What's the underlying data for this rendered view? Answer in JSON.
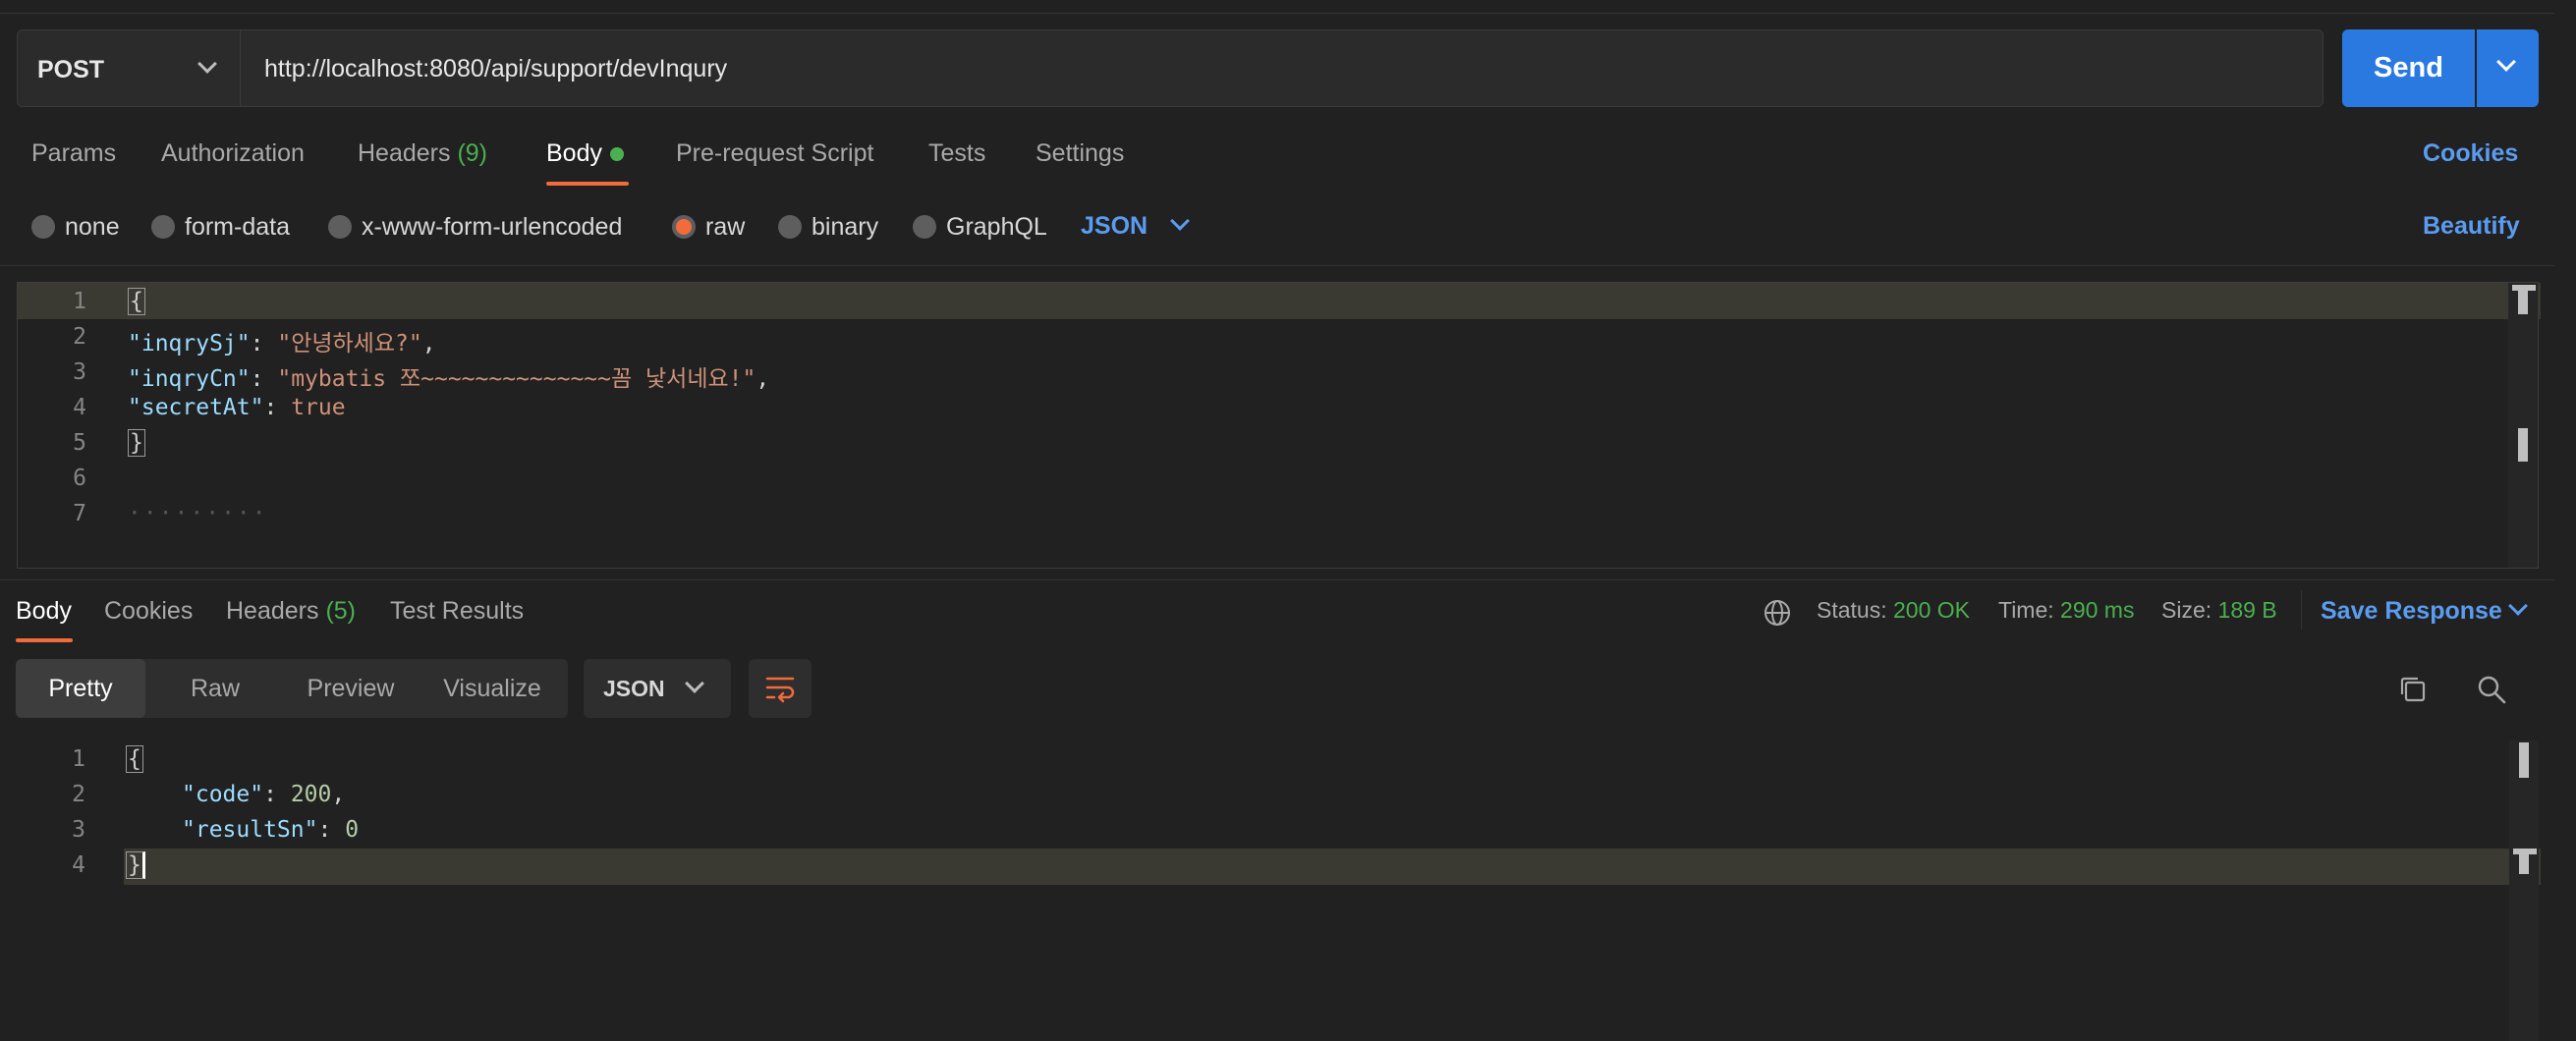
{
  "request": {
    "method": "POST",
    "url": "http://localhost:8080/api/support/devInqury",
    "send_label": "Send"
  },
  "request_tabs": {
    "params": "Params",
    "authorization": "Authorization",
    "headers": "Headers",
    "headers_count": "(9)",
    "body": "Body",
    "pre_request": "Pre-request Script",
    "tests": "Tests",
    "settings": "Settings",
    "cookies": "Cookies"
  },
  "body_types": {
    "none": "none",
    "form_data": "form-data",
    "urlencoded": "x-www-form-urlencoded",
    "raw": "raw",
    "binary": "binary",
    "graphql": "GraphQL",
    "format": "JSON",
    "beautify": "Beautify",
    "selected": "raw"
  },
  "request_body": {
    "line_numbers": [
      "1",
      "2",
      "3",
      "4",
      "5",
      "6",
      "7"
    ],
    "open_brace": "{",
    "close_brace": "}",
    "k1": "\"inqrySj\"",
    "v1": "\"안녕하세요?\"",
    "k2": "\"inqryCn\"",
    "v2": "\"mybatis 쪼~~~~~~~~~~~~~~꼼 낯서네요!\"",
    "k3": "\"secretAt\"",
    "v3": "true",
    "colon": ":",
    "comma": ",",
    "line7_whitespace": "·········"
  },
  "response_tabs": {
    "body": "Body",
    "cookies": "Cookies",
    "headers": "Headers",
    "headers_count": "(5)",
    "test_results": "Test Results"
  },
  "response_meta": {
    "status_label": "Status:",
    "status_value": "200 OK",
    "time_label": "Time:",
    "time_value": "290 ms",
    "size_label": "Size:",
    "size_value": "189 B",
    "save_response": "Save Response"
  },
  "view_modes": {
    "pretty": "Pretty",
    "raw": "Raw",
    "preview": "Preview",
    "visualize": "Visualize",
    "format": "JSON",
    "selected": "Pretty"
  },
  "response_body": {
    "line_numbers": [
      "1",
      "2",
      "3",
      "4"
    ],
    "open_brace": "{",
    "close_brace": "}",
    "k1": "\"code\"",
    "v1": "200",
    "k2": "\"resultSn\"",
    "v2": "0",
    "colon": ":",
    "comma": ","
  },
  "colors": {
    "accent": "#f26b3a",
    "primary": "#2a79e0",
    "link": "#5b9cf0",
    "success": "#4caf50",
    "background": "#212121"
  }
}
